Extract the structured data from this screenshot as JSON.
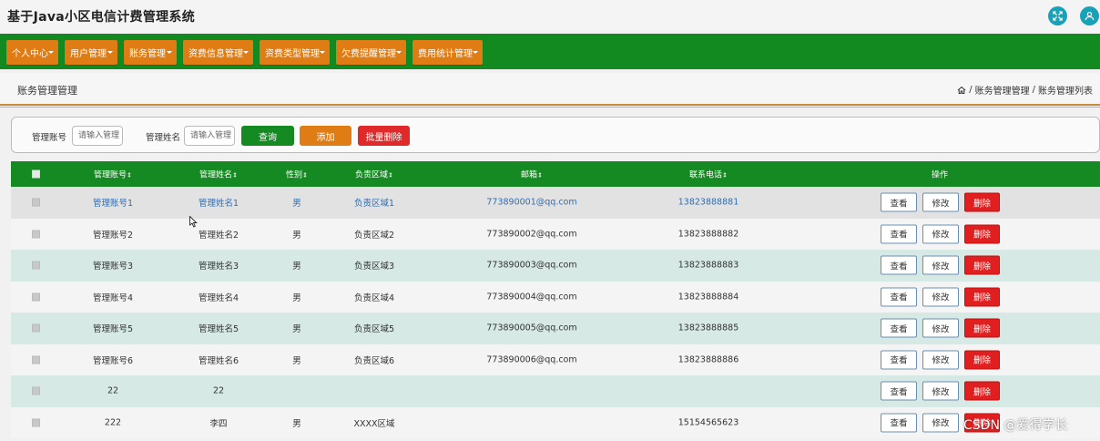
{
  "app": {
    "title": "基于Java小区电信计费管理系统"
  },
  "header_icons": [
    "fullscreen-icon",
    "user-icon"
  ],
  "nav": [
    {
      "label": "个人中心"
    },
    {
      "label": "用户管理"
    },
    {
      "label": "账务管理"
    },
    {
      "label": "资费信息管理"
    },
    {
      "label": "资费类型管理"
    },
    {
      "label": "欠费提醒管理"
    },
    {
      "label": "费用统计管理"
    }
  ],
  "page": {
    "title": "账务管理管理",
    "breadcrumb": [
      "账务管理管理",
      "账务管理列表"
    ],
    "breadcrumb_sep": "/"
  },
  "search": {
    "account_label": "管理账号",
    "account_placeholder": "请输入管理",
    "name_label": "管理姓名",
    "name_placeholder": "请输入管理",
    "query_label": "查询",
    "add_label": "添加",
    "batch_delete_label": "批量删除"
  },
  "table": {
    "columns": [
      "管理账号",
      "管理姓名",
      "性别",
      "负责区域",
      "邮箱",
      "联系电话",
      "操作"
    ],
    "rows": [
      {
        "account": "管理账号1",
        "name": "管理姓名1",
        "gender": "男",
        "area": "负责区域1",
        "email": "773890001@qq.com",
        "phone": "13823888881"
      },
      {
        "account": "管理账号2",
        "name": "管理姓名2",
        "gender": "男",
        "area": "负责区域2",
        "email": "773890002@qq.com",
        "phone": "13823888882"
      },
      {
        "account": "管理账号3",
        "name": "管理姓名3",
        "gender": "男",
        "area": "负责区域3",
        "email": "773890003@qq.com",
        "phone": "13823888883"
      },
      {
        "account": "管理账号4",
        "name": "管理姓名4",
        "gender": "男",
        "area": "负责区域4",
        "email": "773890004@qq.com",
        "phone": "13823888884"
      },
      {
        "account": "管理账号5",
        "name": "管理姓名5",
        "gender": "男",
        "area": "负责区域5",
        "email": "773890005@qq.com",
        "phone": "13823888885"
      },
      {
        "account": "管理账号6",
        "name": "管理姓名6",
        "gender": "男",
        "area": "负责区域6",
        "email": "773890006@qq.com",
        "phone": "13823888886"
      },
      {
        "account": "22",
        "name": "22",
        "gender": "",
        "area": "",
        "email": "",
        "phone": ""
      },
      {
        "account": "222",
        "name": "李四",
        "gender": "男",
        "area": "XXXX区域",
        "email": "",
        "phone": "15154565623"
      }
    ],
    "actions": {
      "view": "查看",
      "edit": "修改",
      "delete": "删除"
    }
  },
  "watermark": "CSDN @爱得学长",
  "colors": {
    "nav_bg": "#138a1f",
    "nav_item": "#e07c14",
    "header_row": "#168a22",
    "query_btn": "#168a22",
    "add_btn": "#e07c14",
    "delete_btn": "#e02020",
    "link": "#2f6eb5",
    "icon_bg": "#17a2b8"
  }
}
